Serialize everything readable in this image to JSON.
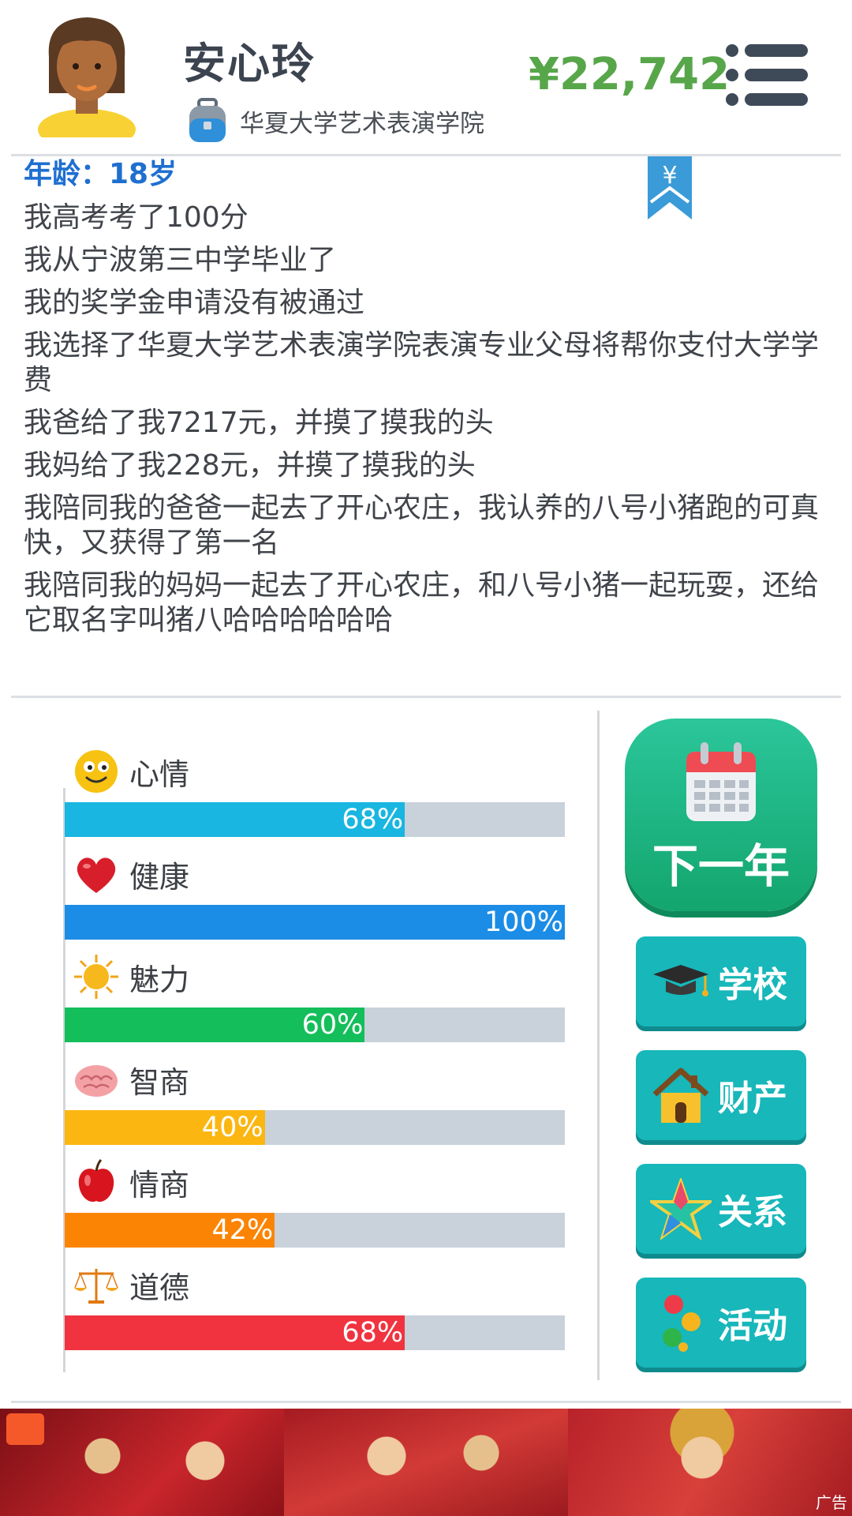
{
  "profile": {
    "name": "安心玲",
    "school": "华夏大学艺术表演学院",
    "money": "¥22,742"
  },
  "log": {
    "age": "年龄：18岁",
    "lines": [
      "我高考考了100分",
      "我从宁波第三中学毕业了",
      "我的奖学金申请没有被通过",
      "我选择了华夏大学艺术表演学院表演专业父母将帮你支付大学学费",
      "我爸给了我7217元，并摸了摸我的头",
      "我妈给了我228元，并摸了摸我的头",
      "我陪同我的爸爸一起去了开心农庄，我认养的八号小猪跑的可真快，又获得了第一名",
      "我陪同我的妈妈一起去了开心农庄，和八号小猪一起玩耍，还给它取名字叫猪八哈哈哈哈哈哈"
    ],
    "bookmark_symbol": "¥"
  },
  "stats": [
    {
      "label": "心情",
      "value": 68,
      "text": "68%",
      "color": "#18b6e0",
      "icon": "smiley-face-icon"
    },
    {
      "label": "健康",
      "value": 100,
      "text": "100%",
      "color": "#1b8de6",
      "icon": "heart-icon"
    },
    {
      "label": "魅力",
      "value": 60,
      "text": "60%",
      "color": "#14be5a",
      "icon": "sun-icon"
    },
    {
      "label": "智商",
      "value": 40,
      "text": "40%",
      "color": "#fbb612",
      "icon": "brain-icon"
    },
    {
      "label": "情商",
      "value": 42,
      "text": "42%",
      "color": "#fb8404",
      "icon": "apple-icon"
    },
    {
      "label": "道德",
      "value": 68,
      "text": "68%",
      "color": "#f0333f",
      "icon": "scales-icon"
    }
  ],
  "buttons": {
    "next_year": "下一年",
    "school": "学校",
    "property": "财产",
    "relations": "关系",
    "activity": "活动"
  },
  "ad": {
    "tag": "广告"
  },
  "colors": {
    "money": "#58a64a",
    "age": "#1f6fd0",
    "next_year_bg": "#1cb87e",
    "side_button_bg": "#17b7ba",
    "bar_track": "#c9d1db"
  }
}
